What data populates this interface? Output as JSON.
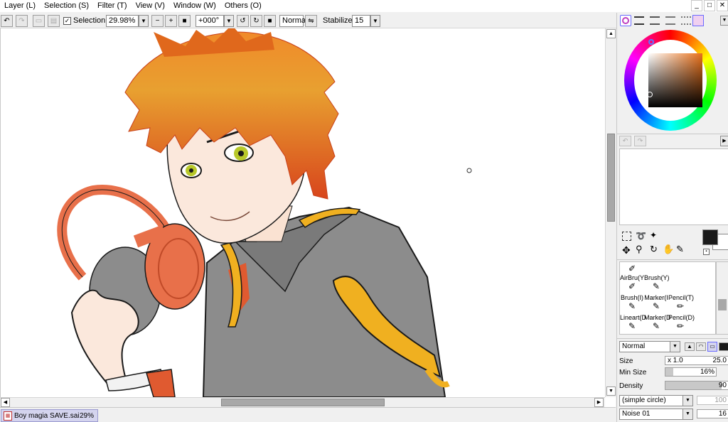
{
  "menu": [
    "Layer (L)",
    "Selection (S)",
    "Filter (T)",
    "View (V)",
    "Window (W)",
    "Others (O)"
  ],
  "window_controls": {
    "minimize": "_",
    "maximize": "□",
    "close": "✕"
  },
  "toolbar": {
    "selection_label": "Selection",
    "selection_checked": true,
    "zoom": "29.98%",
    "rotation": "+000°",
    "blend_mode": "Normal",
    "stabilizer_label": "Stabilizer",
    "stabilizer_value": "15"
  },
  "document_tab": {
    "name": "Boy magia SAVE.sai",
    "zoom": "29%"
  },
  "tools": [
    {
      "label": "AirBru(Y",
      "icon": "airbrush-icon"
    },
    {
      "label": "Brush(Y)",
      "icon": "brush-icon"
    },
    {
      "label": "Brush(I)",
      "icon": "brush-icon"
    },
    {
      "label": "Marker(I",
      "icon": "marker-icon"
    },
    {
      "label": "Pencil(T)",
      "icon": "pencil-icon"
    },
    {
      "label": "Lineart(D",
      "icon": "lineart-icon"
    },
    {
      "label": "Marker(D",
      "icon": "marker-icon"
    },
    {
      "label": "Pencil(D)",
      "icon": "pencil-icon"
    }
  ],
  "brush": {
    "blend_mode": "Normal",
    "size_label": "Size",
    "size_multiplier": "x 1.0",
    "size_value": "25.0",
    "min_size_label": "Min Size",
    "min_size_value": "16%",
    "min_size_fraction": 0.16,
    "density_label": "Density",
    "density_value": "90",
    "density_fraction": 0.9,
    "shape": "(simple circle)",
    "shape_value": "100",
    "texture": "Noise 01",
    "texture_value": "16"
  },
  "colors": {
    "primary": "#1a1a1a",
    "secondary": "#ffffff",
    "accent": "#e8883a"
  }
}
